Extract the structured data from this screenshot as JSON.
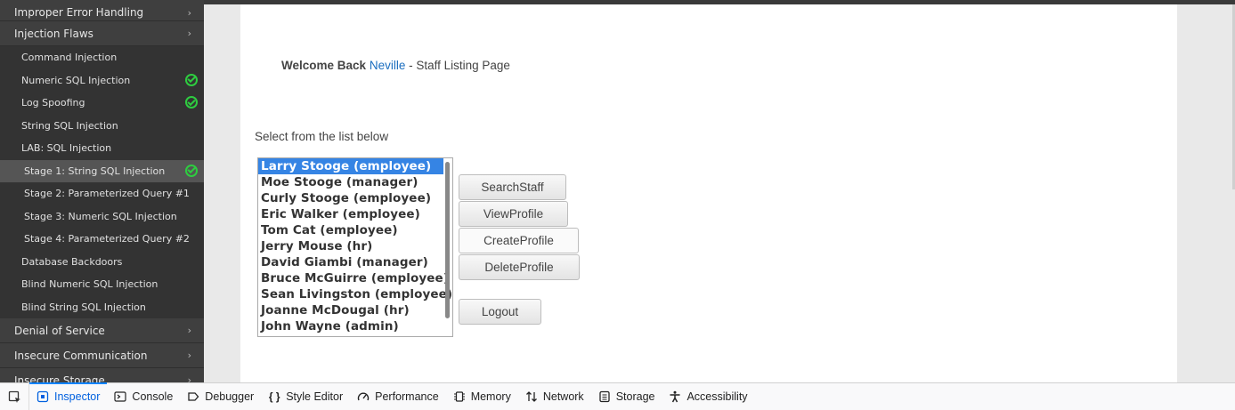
{
  "sidebar": {
    "top_category": "Improper Error Handling",
    "injection_category": "Injection Flaws",
    "items": [
      {
        "label": "Command Injection",
        "done": false
      },
      {
        "label": "Numeric SQL Injection",
        "done": true
      },
      {
        "label": "Log Spoofing",
        "done": true
      },
      {
        "label": "String SQL Injection",
        "done": false
      },
      {
        "label": "LAB: SQL Injection",
        "done": false
      }
    ],
    "stages": [
      {
        "label": "Stage 1: String SQL Injection",
        "done": true,
        "active": true
      },
      {
        "label": "Stage 2: Parameterized Query #1",
        "done": false
      },
      {
        "label": "Stage 3: Numeric SQL Injection",
        "done": false
      },
      {
        "label": "Stage 4: Parameterized Query #2",
        "done": false
      }
    ],
    "items_after": [
      {
        "label": "Database Backdoors"
      },
      {
        "label": "Blind Numeric SQL Injection"
      },
      {
        "label": "Blind String SQL Injection"
      }
    ],
    "categories_after": [
      {
        "label": "Denial of Service"
      },
      {
        "label": "Insecure Communication"
      },
      {
        "label": "Insecure Storage"
      }
    ]
  },
  "main": {
    "welcome_prefix": "Welcome Back",
    "user_name": "Neville",
    "welcome_suffix": "- Staff Listing Page",
    "select_label": "Select from the list below",
    "staff": [
      "Larry Stooge (employee)",
      "Moe Stooge (manager)",
      "Curly Stooge (employee)",
      "Eric Walker (employee)",
      "Tom Cat (employee)",
      "Jerry Mouse (hr)",
      "David Giambi (manager)",
      "Bruce McGuirre (employee)",
      "Sean Livingston (employee)",
      "Joanne McDougal (hr)",
      "John Wayne (admin)"
    ],
    "selected_staff": "Larry Stooge (employee)",
    "buttons": {
      "search": "SearchStaff",
      "view": "ViewProfile",
      "create": "CreateProfile",
      "delete": "DeleteProfile",
      "logout": "Logout"
    }
  },
  "devtools": {
    "tabs": [
      {
        "label": "Inspector",
        "icon": "inspector-icon",
        "active": true
      },
      {
        "label": "Console",
        "icon": "console-icon"
      },
      {
        "label": "Debugger",
        "icon": "debugger-icon"
      },
      {
        "label": "Style Editor",
        "icon": "style-editor-icon"
      },
      {
        "label": "Performance",
        "icon": "performance-icon"
      },
      {
        "label": "Memory",
        "icon": "memory-icon"
      },
      {
        "label": "Network",
        "icon": "network-icon"
      },
      {
        "label": "Storage",
        "icon": "storage-icon"
      },
      {
        "label": "Accessibility",
        "icon": "accessibility-icon"
      }
    ],
    "accent_color": "#0a84ff"
  }
}
